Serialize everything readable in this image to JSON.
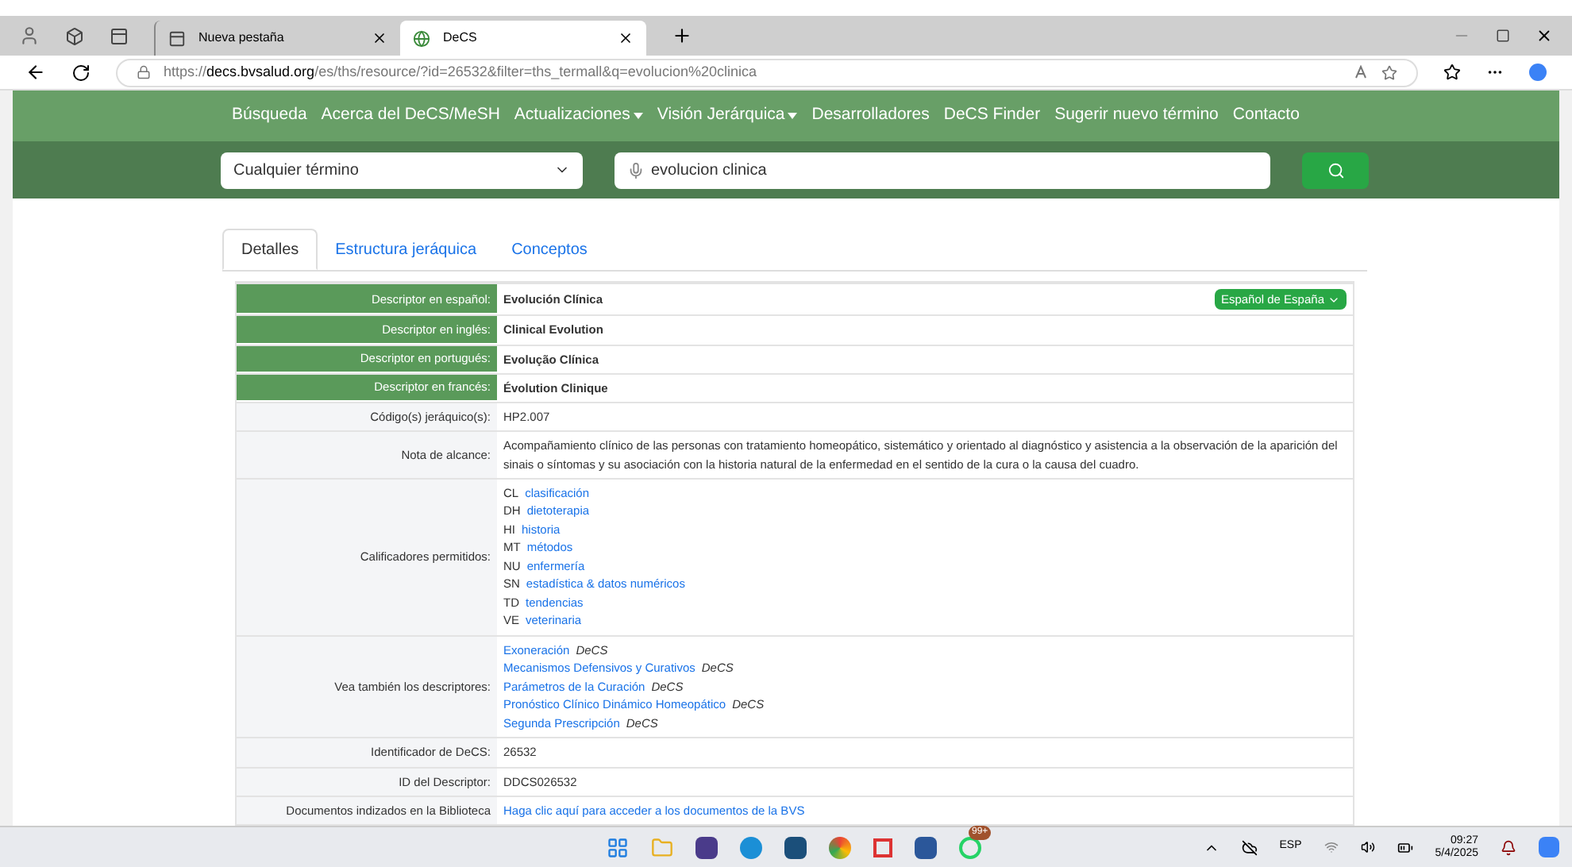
{
  "browser": {
    "tabs": [
      {
        "title": "Nueva pestaña",
        "selected": false
      },
      {
        "title": "DeCS",
        "selected": true
      }
    ],
    "url": {
      "scheme": "https://",
      "host": "decs.bvsalud.org",
      "path": "/es/ths/resource/?id=26532&filter=ths_termall&q=evolucion%20clinica"
    }
  },
  "nav": [
    {
      "label": "Búsqueda",
      "dropdown": false
    },
    {
      "label": "Acerca del DeCS/MeSH",
      "dropdown": false
    },
    {
      "label": "Actualizaciones",
      "dropdown": true
    },
    {
      "label": "Visión Jerárquica",
      "dropdown": true
    },
    {
      "label": "Desarrolladores",
      "dropdown": false
    },
    {
      "label": "DeCS Finder",
      "dropdown": false
    },
    {
      "label": "Sugerir nuevo término",
      "dropdown": false
    },
    {
      "label": "Contacto",
      "dropdown": false
    }
  ],
  "search": {
    "scope": "Cualquier término",
    "query": "evolucion clinica"
  },
  "tabs": [
    {
      "label": "Detalles",
      "selected": true
    },
    {
      "label": "Estructura jeráquica",
      "selected": false
    },
    {
      "label": "Conceptos",
      "selected": false
    }
  ],
  "language_button": "Español de España",
  "rows": [
    {
      "kind": "text",
      "label": "Descriptor en español:",
      "highlighted": true,
      "bold": true,
      "value": "Evolución Clínica"
    },
    {
      "kind": "text",
      "label": "Descriptor en inglés:",
      "highlighted": true,
      "bold": true,
      "value": "Clinical Evolution"
    },
    {
      "kind": "text",
      "label": "Descriptor en portugués:",
      "highlighted": true,
      "bold": true,
      "value": "Evolução Clínica"
    },
    {
      "kind": "text",
      "label": "Descriptor en francés:",
      "highlighted": true,
      "bold": true,
      "value": "Évolution Clinique"
    },
    {
      "kind": "text",
      "label": "Código(s) jeráquico(s):",
      "highlighted": false,
      "bold": false,
      "value": "HP2.007"
    },
    {
      "kind": "text",
      "label": "Nota de alcance:",
      "highlighted": false,
      "bold": false,
      "value": "Acompañamiento clínico de las personas con tratamiento homeopático, sistemático y orientado al diagnóstico y asistencia a la observación de la aparición del sinais o síntomas y su asociación con la historia natural de la enfermedad en el sentido de la cura o la causa del cuadro."
    },
    {
      "kind": "qualifiers",
      "label": "Calificadores permitidos:",
      "items": [
        {
          "code": "CL",
          "name": "clasificación"
        },
        {
          "code": "DH",
          "name": "dietoterapia"
        },
        {
          "code": "HI",
          "name": "historia"
        },
        {
          "code": "MT",
          "name": "métodos"
        },
        {
          "code": "NU",
          "name": "enfermería"
        },
        {
          "code": "SN",
          "name": "estadística & datos numéricos"
        },
        {
          "code": "TD",
          "name": "tendencias"
        },
        {
          "code": "VE",
          "name": "veterinaria"
        }
      ]
    },
    {
      "kind": "links",
      "label": "Vea también los descriptores:",
      "items": [
        {
          "name": "Exoneración",
          "source": "DeCS"
        },
        {
          "name": "Mecanismos Defensivos y Curativos",
          "source": "DeCS"
        },
        {
          "name": "Parámetros de la Curación",
          "source": "DeCS"
        },
        {
          "name": "Pronóstico Clínico Dinámico Homeopático",
          "source": "DeCS"
        },
        {
          "name": "Segunda Prescripción",
          "source": "DeCS"
        }
      ]
    },
    {
      "kind": "text",
      "label": "Identificador de DeCS:",
      "highlighted": false,
      "bold": false,
      "value": "26532"
    },
    {
      "kind": "text",
      "label": "ID del Descriptor:",
      "highlighted": false,
      "bold": false,
      "value": "DDCS026532"
    },
    {
      "kind": "link",
      "label": "Documentos indizados en la Biblioteca",
      "value": "Haga clic aquí para acceder a los documentos de la BVS"
    }
  ],
  "taskbar": {
    "badge": "99+",
    "language": "ESP",
    "time": "09:27",
    "date": "5/4/2025"
  }
}
